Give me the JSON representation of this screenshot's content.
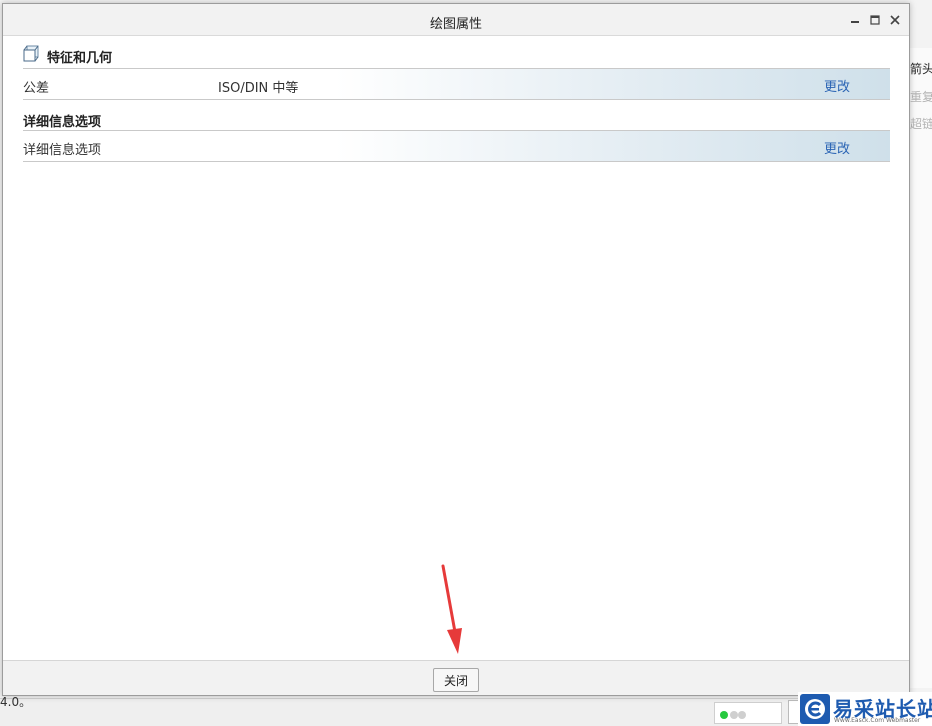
{
  "dialog": {
    "title": "绘图属性",
    "close_label": "关闭"
  },
  "sections": {
    "features": {
      "heading": "特征和几何",
      "rows": [
        {
          "name": "公差",
          "value": "ISO/DIN 中等",
          "action": "更改"
        }
      ]
    },
    "details": {
      "heading": "详细信息选项",
      "rows": [
        {
          "name": "详细信息选项",
          "value": "",
          "action": "更改"
        }
      ]
    }
  },
  "background": {
    "right_panel_labels": [
      "箭头",
      "重复",
      "超链"
    ],
    "status_text": "4.0。"
  },
  "watermark": {
    "title": "易采站长站",
    "url": "Www.Easck.Com Webmaster"
  },
  "colors": {
    "link": "#2a64b4",
    "arrow": "#e63a3a",
    "watermark_brand": "#1e5bb0"
  }
}
